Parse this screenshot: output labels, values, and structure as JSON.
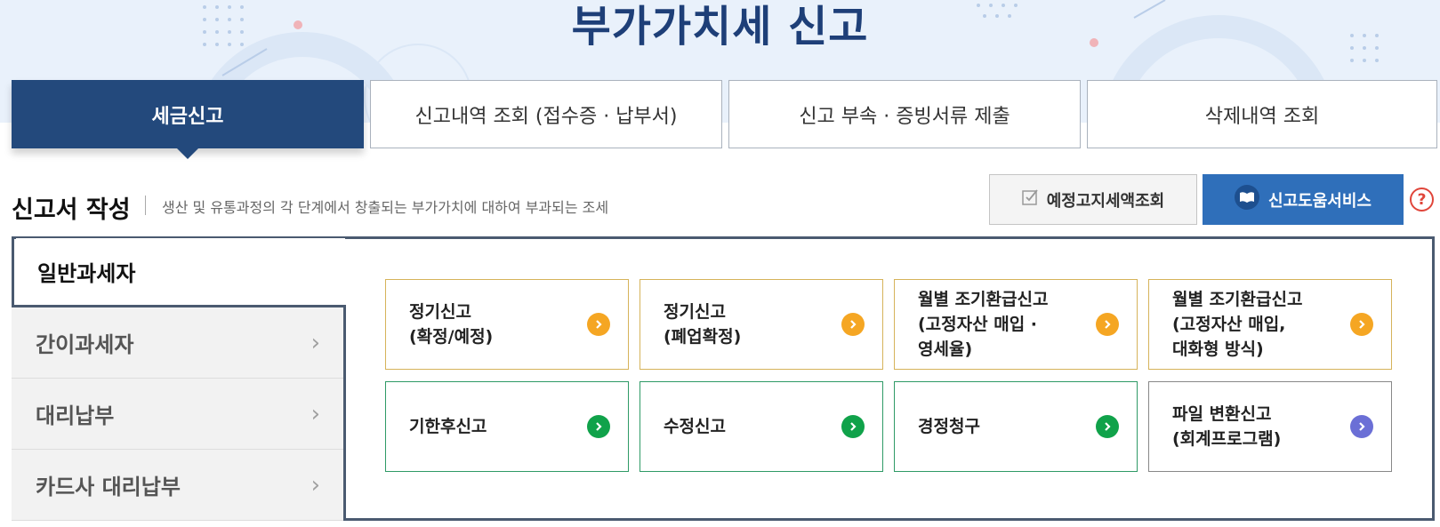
{
  "page_title": "부가가치세 신고",
  "tabs": [
    {
      "label": "세금신고",
      "active": true
    },
    {
      "label": "신고내역 조회 (접수증 · 납부서)",
      "active": false
    },
    {
      "label": "신고 부속 · 증빙서류 제출",
      "active": false
    },
    {
      "label": "삭제내역 조회",
      "active": false
    }
  ],
  "section": {
    "title": "신고서 작성",
    "description": "생산 및 유통과정의 각 단계에서 창출되는 부가가치에 대하여 부과되는 조세"
  },
  "actions": {
    "scheduled_tax_lookup": "예정고지세액조회",
    "filing_help_service": "신고도움서비스",
    "help_icon": "?"
  },
  "sidebar": {
    "active": "일반과세자",
    "items": [
      {
        "label": "간이과세자"
      },
      {
        "label": "대리납부"
      },
      {
        "label": "카드사 대리납부"
      }
    ]
  },
  "cards": [
    {
      "label": "정기신고\n(확정/예정)",
      "color": "#f5a623"
    },
    {
      "label": "정기신고\n(폐업확정)",
      "color": "#f5a623"
    },
    {
      "label": "월별 조기환급신고\n(고정자산 매입 ·\n영세율)",
      "color": "#f5a623"
    },
    {
      "label": "월별 조기환급신고\n(고정자산 매입,\n대화형 방식)",
      "color": "#f5a623"
    },
    {
      "label": "기한후신고",
      "color": "#10a24a"
    },
    {
      "label": "수정신고",
      "color": "#10a24a"
    },
    {
      "label": "경정청구",
      "color": "#10a24a"
    },
    {
      "label": "파일 변환신고\n(회계프로그램)",
      "color": "#6b6fd6"
    }
  ],
  "colors": {
    "primary_navy": "#23497c",
    "help_blue": "#2f6fba",
    "title_navy": "#1e3f78"
  }
}
